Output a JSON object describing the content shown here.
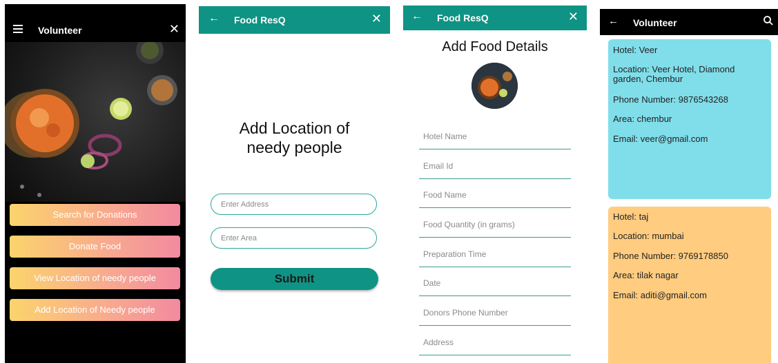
{
  "screen1": {
    "title": "Volunteer",
    "buttons": [
      "Search for Donations",
      "Donate Food",
      "View Location of needy people",
      "Add Location of Needy people"
    ],
    "gradient_colors": [
      "#fbd46c",
      "#f28aa0"
    ]
  },
  "screen2": {
    "app_title": "Food ResQ",
    "heading_line1": "Add Location of",
    "heading_line2": "needy people",
    "address_placeholder": "Enter Address",
    "area_placeholder": "Enter Area",
    "submit_label": "Submit",
    "accent": "#0f9384"
  },
  "screen3": {
    "app_title": "Food ResQ",
    "heading": "Add Food Details",
    "fields": [
      "Hotel Name",
      "Email Id",
      "Food Name",
      "Food Quantity (in grams)",
      "Preparation Time",
      "Date",
      "Donors Phone Number",
      "Address"
    ]
  },
  "screen4": {
    "title": "Volunteer",
    "cards": [
      {
        "hotel": "Hotel: Veer",
        "location": "Location: Veer Hotel, Diamond garden, Chembur",
        "phone": "Phone Number: 9876543268",
        "area": "Area: chembur",
        "email": "Email: veer@gmail.com",
        "color": "#80deea"
      },
      {
        "hotel": "Hotel: taj",
        "location": "Location: mumbai",
        "phone": "Phone Number: 9769178850",
        "area": "Area: tilak nagar",
        "email": "Email: aditi@gmail.com",
        "color": "#ffcc80"
      }
    ]
  }
}
